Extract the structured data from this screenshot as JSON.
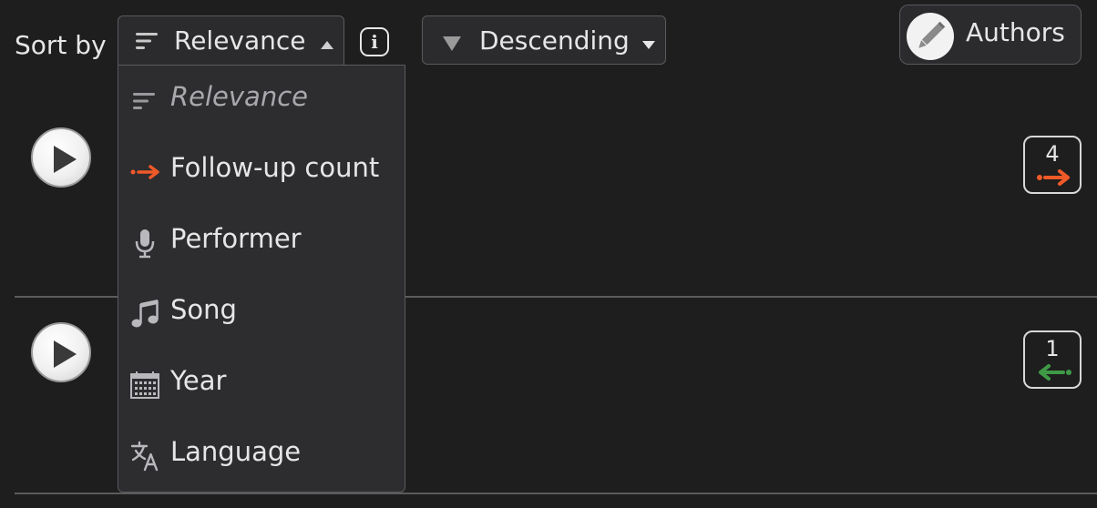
{
  "toolbar": {
    "sort_label": "Sort by",
    "sort_selected": "Relevance",
    "info_label": "i",
    "order_selected": "Descending",
    "authors_label": "Authors"
  },
  "sort_menu": {
    "items": [
      {
        "label": "Relevance",
        "icon": "sort-lines-icon",
        "selected": true
      },
      {
        "label": "Follow-up count",
        "icon": "arrow-right-icon",
        "color": "#f05a28"
      },
      {
        "label": "Performer",
        "icon": "microphone-icon"
      },
      {
        "label": "Song",
        "icon": "music-note-icon"
      },
      {
        "label": "Year",
        "icon": "calendar-icon"
      },
      {
        "label": "Language",
        "icon": "translate-icon"
      }
    ]
  },
  "results": [
    {
      "follow_up_count": "4",
      "direction": "outgoing",
      "color": "#f05a28"
    },
    {
      "follow_up_count": "1",
      "direction": "incoming",
      "color": "#3f9a46"
    }
  ]
}
